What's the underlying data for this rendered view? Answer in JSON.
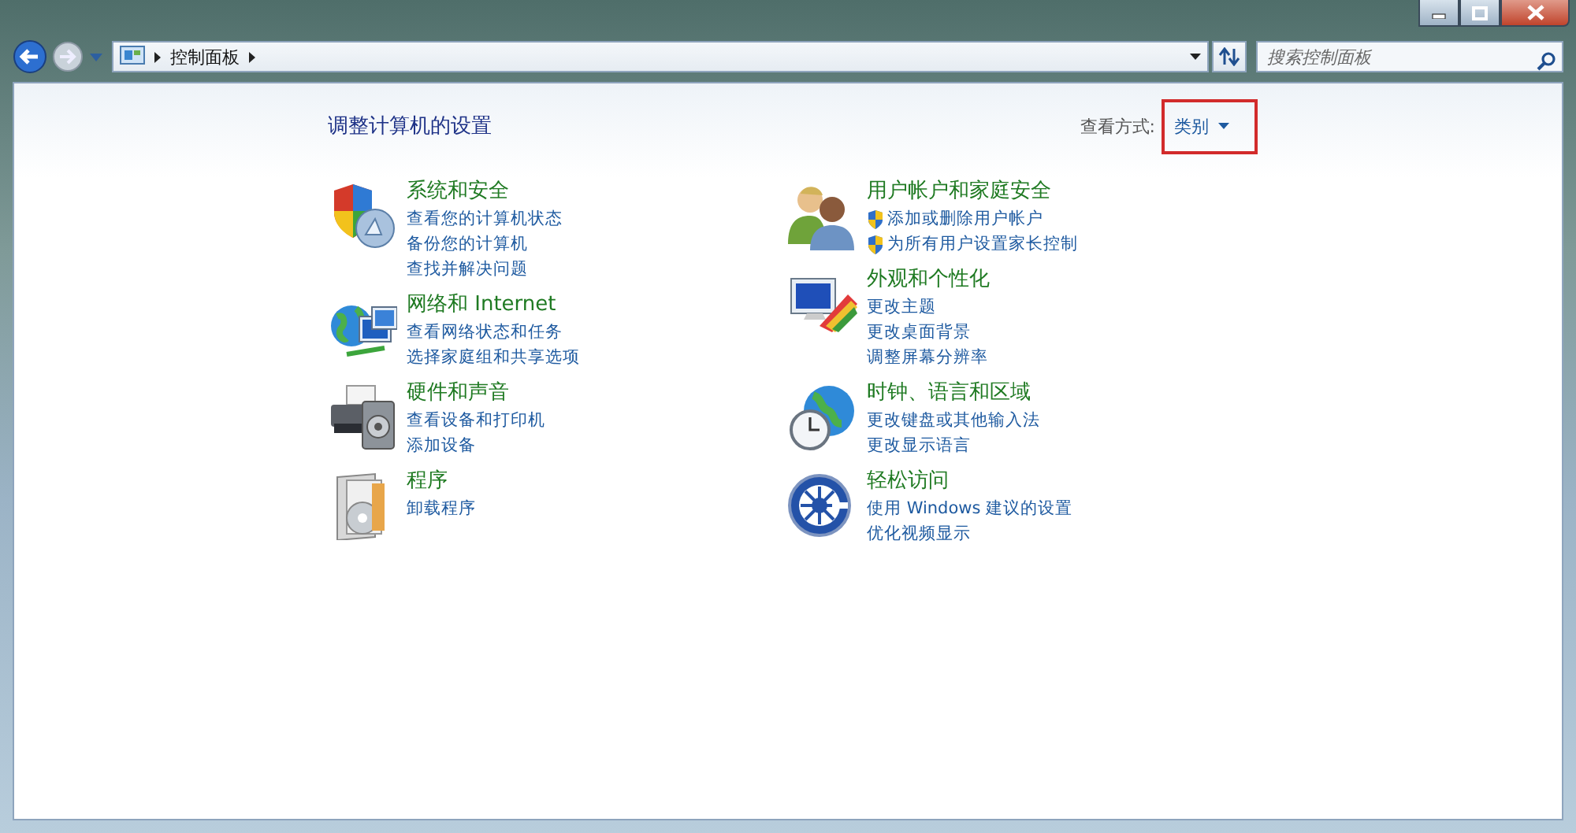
{
  "address_bar": {
    "path": [
      {
        "label": "控制面板"
      }
    ]
  },
  "search": {
    "placeholder": "搜索控制面板"
  },
  "page": {
    "title": "调整计算机的设置"
  },
  "view_by": {
    "label": "查看方式:",
    "value": "类别",
    "highlighted": true
  },
  "columns": [
    {
      "categories": [
        {
          "title": "系统和安全",
          "links": [
            {
              "label": "查看您的计算机状态",
              "shield": false
            },
            {
              "label": "备份您的计算机",
              "shield": false
            },
            {
              "label": "查找并解决问题",
              "shield": false
            }
          ]
        },
        {
          "title": "网络和 Internet",
          "links": [
            {
              "label": "查看网络状态和任务",
              "shield": false
            },
            {
              "label": "选择家庭组和共享选项",
              "shield": false
            }
          ]
        },
        {
          "title": "硬件和声音",
          "links": [
            {
              "label": "查看设备和打印机",
              "shield": false
            },
            {
              "label": "添加设备",
              "shield": false
            }
          ]
        },
        {
          "title": "程序",
          "links": [
            {
              "label": "卸载程序",
              "shield": false
            }
          ]
        }
      ]
    },
    {
      "categories": [
        {
          "title": "用户帐户和家庭安全",
          "links": [
            {
              "label": "添加或删除用户帐户",
              "shield": true
            },
            {
              "label": "为所有用户设置家长控制",
              "shield": true
            }
          ]
        },
        {
          "title": "外观和个性化",
          "links": [
            {
              "label": "更改主题",
              "shield": false
            },
            {
              "label": "更改桌面背景",
              "shield": false
            },
            {
              "label": "调整屏幕分辨率",
              "shield": false
            }
          ]
        },
        {
          "title": "时钟、语言和区域",
          "links": [
            {
              "label": "更改键盘或其他输入法",
              "shield": false
            },
            {
              "label": "更改显示语言",
              "shield": false
            }
          ]
        },
        {
          "title": "轻松访问",
          "links": [
            {
              "label": "使用 Windows 建议的设置",
              "shield": false
            },
            {
              "label": "优化视频显示",
              "shield": false
            }
          ]
        }
      ]
    }
  ]
}
